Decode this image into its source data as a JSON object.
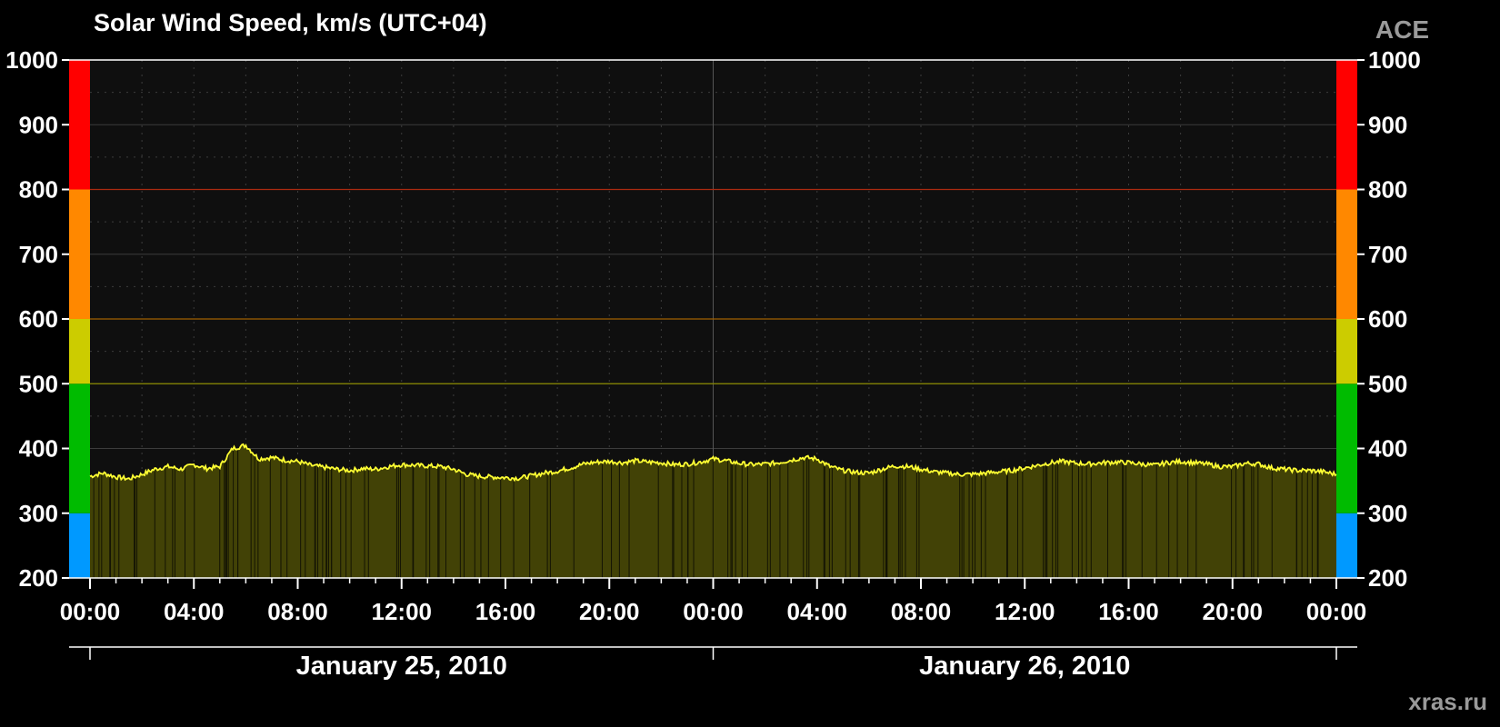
{
  "header": {
    "title": "Solar Wind Speed, km/s (UTC+04)",
    "source": "ACE"
  },
  "footer": {
    "site": "xras.ru"
  },
  "colors": {
    "background": "#000000",
    "plot_background": "#0f0f0f",
    "line": "#ffff33",
    "fill": "#424206",
    "grid": "#3c3c3c",
    "blue": "#0099ff",
    "green": "#00bb00",
    "yellow": "#cccc00",
    "orange": "#ff8800",
    "red": "#ff0000"
  },
  "chart_data": {
    "type": "area",
    "title": "Solar Wind Speed, km/s (UTC+04)",
    "xlabel": "",
    "ylabel": "",
    "ylim": [
      200,
      1000
    ],
    "y_ticks": [
      "1000",
      "900",
      "800",
      "700",
      "600",
      "500",
      "400",
      "300",
      "200"
    ],
    "x_range_hours": [
      0,
      48
    ],
    "x_tick_labels": [
      "00:00",
      "04:00",
      "08:00",
      "12:00",
      "16:00",
      "20:00",
      "00:00",
      "04:00",
      "08:00",
      "12:00",
      "16:00",
      "20:00",
      "00:00"
    ],
    "dates": [
      "January 25, 2010",
      "January 26, 2010"
    ],
    "grid": true,
    "activity_bands": [
      {
        "from": 200,
        "to": 300,
        "color": "#0099ff"
      },
      {
        "from": 300,
        "to": 500,
        "color": "#00bb00"
      },
      {
        "from": 500,
        "to": 600,
        "color": "#cccc00"
      },
      {
        "from": 600,
        "to": 800,
        "color": "#ff8800"
      },
      {
        "from": 800,
        "to": 1000,
        "color": "#ff0000"
      }
    ],
    "threshold_lines": [
      {
        "value": 500,
        "color": "#8a8a00"
      },
      {
        "value": 600,
        "color": "#a06000"
      },
      {
        "value": 800,
        "color": "#aa2a10"
      }
    ],
    "series": [
      {
        "x_hours": [
          0,
          0.5,
          1,
          1.5,
          2,
          2.5,
          3,
          3.5,
          4,
          4.5,
          5,
          5.5,
          6,
          6.5,
          7,
          7.5,
          8,
          8.5,
          9,
          9.5,
          10,
          10.5,
          11,
          11.5,
          12,
          12.5,
          13,
          13.5,
          14,
          14.5,
          15,
          15.5,
          16,
          16.5,
          17,
          17.5,
          18,
          18.5,
          19,
          19.5,
          20,
          20.5,
          21,
          21.5,
          22,
          22.5,
          23,
          23.5,
          24,
          24.5,
          25,
          25.5,
          26,
          26.5,
          27,
          27.5,
          28,
          28.5,
          29,
          29.5,
          30,
          30.5,
          31,
          31.5,
          32,
          32.5,
          33,
          33.5,
          34,
          34.5,
          35,
          35.5,
          36,
          36.5,
          37,
          37.5,
          38,
          38.5,
          39,
          39.5,
          40,
          40.5,
          41,
          41.5,
          42,
          42.5,
          43,
          43.5,
          44,
          44.5,
          45,
          45.5,
          46,
          46.5,
          47,
          47.5,
          48
        ],
        "values": [
          357,
          362,
          356,
          353,
          360,
          368,
          372,
          368,
          375,
          369,
          372,
          400,
          405,
          384,
          386,
          382,
          380,
          374,
          371,
          368,
          366,
          369,
          368,
          372,
          375,
          374,
          373,
          372,
          368,
          360,
          357,
          356,
          355,
          354,
          358,
          362,
          365,
          370,
          376,
          379,
          380,
          378,
          381,
          379,
          378,
          375,
          376,
          379,
          384,
          381,
          377,
          375,
          376,
          378,
          382,
          386,
          384,
          372,
          366,
          363,
          362,
          368,
          373,
          372,
          368,
          364,
          362,
          360,
          360,
          362,
          364,
          366,
          370,
          374,
          378,
          380,
          377,
          376,
          378,
          379,
          378,
          376,
          374,
          378,
          380,
          378,
          376,
          372,
          372,
          377,
          376,
          370,
          368,
          366,
          366,
          364,
          360
        ]
      }
    ]
  }
}
